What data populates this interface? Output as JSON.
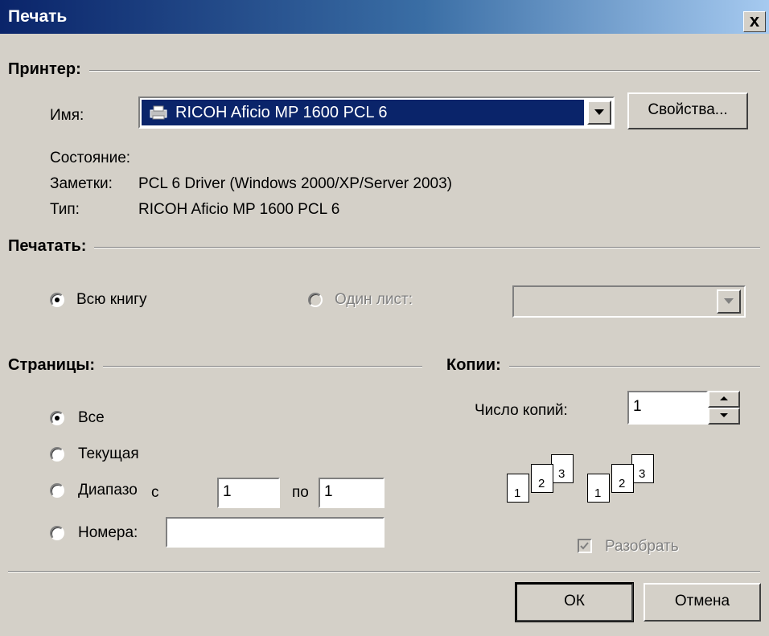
{
  "title": "Печать",
  "close_label": "x",
  "printer": {
    "group_title": "Принтер:",
    "name_label": "Имя:",
    "name_value": "RICOH Aficio MP 1600 PCL 6",
    "properties_button": "Свойства...",
    "status_label": "Состояние:",
    "notes_label": "Заметки:",
    "notes_value": "PCL 6 Driver (Windows 2000/XP/Server 2003)",
    "type_label": "Тип:",
    "type_value": "RICOH Aficio MP 1600 PCL 6"
  },
  "print_what": {
    "group_title": "Печатать:",
    "whole_book": "Всю книгу",
    "one_sheet": "Один лист:",
    "sheet_value": ""
  },
  "pages": {
    "group_title": "Страницы:",
    "all": "Все",
    "current": "Текущая",
    "range": "Диапазо",
    "from_label": "с",
    "from_value": "1",
    "to_label": "по",
    "to_value": "1",
    "numbers": "Номера:",
    "numbers_value": ""
  },
  "copies": {
    "group_title": "Копии:",
    "count_label": "Число копий:",
    "count_value": "1",
    "collate_icon_pages": [
      "1",
      "2",
      "3"
    ],
    "collate_label": "Разобрать",
    "collate_checked": true
  },
  "buttons": {
    "ok": "ОК",
    "cancel": "Отмена"
  }
}
